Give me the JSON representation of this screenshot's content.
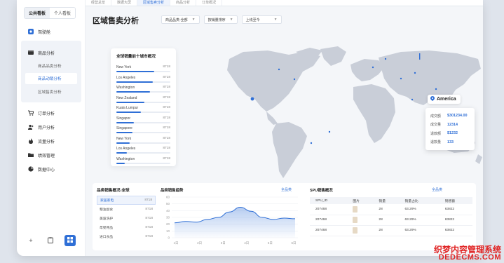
{
  "sidebar": {
    "tabs": [
      "公共看板",
      "个人看板"
    ],
    "menu": {
      "driving": "驾驶舱",
      "goods": "商品分析",
      "goods_subs": [
        "商品品类分析",
        "商品动销分析",
        "区域售卖分析"
      ],
      "orders": "订单分析",
      "users": "用户分析",
      "traffic": "流量分析",
      "performance": "绩效管理",
      "data_center": "数据中心"
    }
  },
  "top_tabs": [
    "经营总览",
    "数据大屏",
    "区域售卖分析",
    "商品分析",
    "订单概况"
  ],
  "page": {
    "title": "区域售卖分析",
    "filters": [
      "商品品类-全部",
      "按销量排序",
      "上线至今"
    ]
  },
  "top10": {
    "title": "全球销量前十城市概况",
    "rows": [
      {
        "name": "New York",
        "value": "8718",
        "share": 0.7
      },
      {
        "name": "Los Angeles",
        "value": "8718",
        "share": 0.68
      },
      {
        "name": "Washington",
        "value": "8718",
        "share": 0.62
      },
      {
        "name": "New Zealand",
        "value": "8718",
        "share": 0.52
      },
      {
        "name": "Kuala Lumpur",
        "value": "8718",
        "share": 0.45
      },
      {
        "name": "Singapor",
        "value": "8718",
        "share": 0.32
      },
      {
        "name": "Singapore",
        "value": "8718",
        "share": 0.3
      },
      {
        "name": "New York",
        "value": "8718",
        "share": 0.25
      },
      {
        "name": "Los Angeles",
        "value": "8718",
        "share": 0.2
      },
      {
        "name": "Washington",
        "value": "8718",
        "share": 0.15
      }
    ]
  },
  "popup": {
    "region": "America",
    "rows": [
      {
        "k": "成交额",
        "v": "$301234.00"
      },
      {
        "k": "成交量",
        "v": "12314"
      },
      {
        "k": "退款额",
        "v": "$1232"
      },
      {
        "k": "退款量",
        "v": "133"
      }
    ]
  },
  "category": {
    "title": "品类销售概况-全球",
    "rows": [
      {
        "name": "家居家电",
        "value": "8718"
      },
      {
        "name": "粮油副食",
        "value": "8718"
      },
      {
        "name": "美容洗护",
        "value": "8718"
      },
      {
        "name": "母婴用品",
        "value": "8718"
      },
      {
        "name": "进口食品",
        "value": "8718"
      }
    ]
  },
  "trend": {
    "title": "品类销售趋势",
    "link": "全品类"
  },
  "chart_data": {
    "type": "area",
    "x": [
      "1日",
      "2日",
      "3日",
      "4日",
      "5日",
      "6日"
    ],
    "series": [
      {
        "values": [
          22,
          24,
          23,
          27,
          30,
          38,
          45,
          39,
          30,
          27,
          29,
          28
        ]
      }
    ],
    "ylim": [
      0,
      60
    ],
    "yticks": [
      "0",
      "10",
      "20",
      "30",
      "40",
      "50",
      "60"
    ],
    "grid": true
  },
  "spu": {
    "title": "SPU销售概况",
    "link": "全品类",
    "headers": [
      "SPU_ID",
      "图片",
      "销量",
      "销量占比",
      "销售额"
    ],
    "rows": [
      [
        "207468",
        "",
        "28",
        "63.29%",
        "63822"
      ],
      [
        "207468",
        "",
        "28",
        "63.29%",
        "63822"
      ],
      [
        "207468",
        "",
        "28",
        "63.29%",
        "63822"
      ]
    ]
  },
  "watermark": {
    "line1": "织梦内容管理系统",
    "line2": "DEDECMS.COM"
  }
}
